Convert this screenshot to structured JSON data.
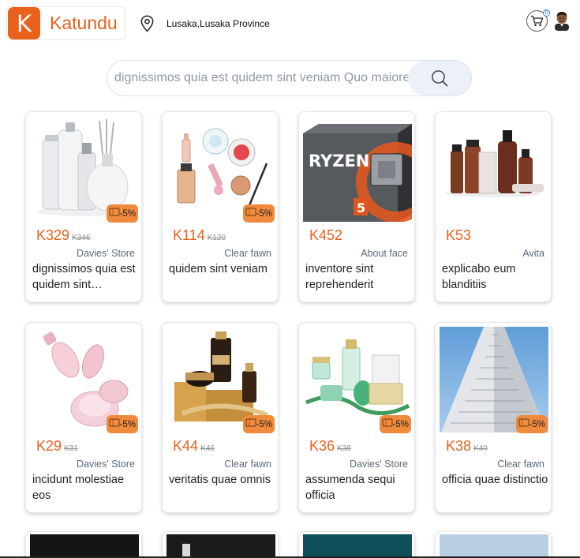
{
  "header": {
    "logo_letter": "K",
    "brand": "Katundu",
    "location": "Lusaka,Lusaka Province",
    "cart_count": "0",
    "brand_color": "#e8621d"
  },
  "search": {
    "value": "dignissimos quia est quidem sint veniam Quo maiores",
    "icon": "search-icon"
  },
  "products": [
    {
      "price": "K329",
      "old_price": "K346",
      "discount": "-5%",
      "store": "Davies' Store",
      "title": "dignissimos quia est quidem sint…"
    },
    {
      "price": "K114",
      "old_price": "K120",
      "discount": "-5%",
      "store": "Clear fawn",
      "title": "quidem sint veniam"
    },
    {
      "price": "K452",
      "old_price": "",
      "discount": "",
      "store": "About face",
      "title": "inventore sint reprehenderit"
    },
    {
      "price": "K53",
      "old_price": "",
      "discount": "",
      "store": "Avita",
      "title": "explicabo eum blanditiis"
    },
    {
      "price": "K29",
      "old_price": "K31",
      "discount": "-5%",
      "store": "Davies' Store",
      "title": "incidunt molestiae eos"
    },
    {
      "price": "K44",
      "old_price": "K46",
      "discount": "-5%",
      "store": "Clear fawn",
      "title": "veritatis quae omnis"
    },
    {
      "price": "K36",
      "old_price": "K38",
      "discount": "-5%",
      "store": "Davies' Store",
      "title": "assumenda sequi officia"
    },
    {
      "price": "K38",
      "old_price": "K40",
      "discount": "-5%",
      "store": "Clear fawn",
      "title": "officia quae distinctio"
    }
  ],
  "product_images": [
    "skincare-bottles",
    "makeup-cosmetics",
    "ryzen-processor-box",
    "grooming-bottles",
    "pink-serum-bottles",
    "luxury-cream-jars",
    "green-cosmetic-set",
    "skyscraper-photo",
    "dark-product",
    "dark-product",
    "teal-product",
    "sky-product"
  ],
  "colors": {
    "discount_badge": "#f08a3c",
    "store_text": "#5b6b7b",
    "search_button": "#ecf1f7"
  }
}
